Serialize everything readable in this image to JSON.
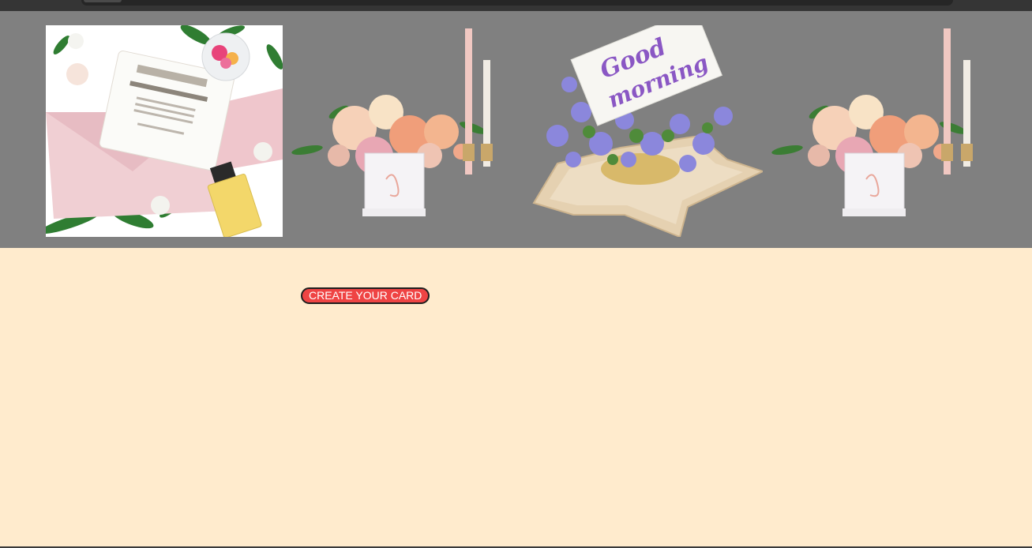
{
  "gallery": {
    "images": [
      {
        "name": "invitation-flatlay-photo"
      },
      {
        "name": "peach-bouquet-candles-photo"
      },
      {
        "name": "good-morning-flowers-photo",
        "card_text": [
          "Good",
          "morning"
        ]
      },
      {
        "name": "peach-bouquet-candles-photo"
      }
    ]
  },
  "main": {
    "cta_label": "CREATE YOUR CARD"
  },
  "colors": {
    "page_bg": "#ffebcd",
    "gallery_bg": "#808080",
    "cta_bg": "#ef4444",
    "top_bar": "#353535"
  }
}
